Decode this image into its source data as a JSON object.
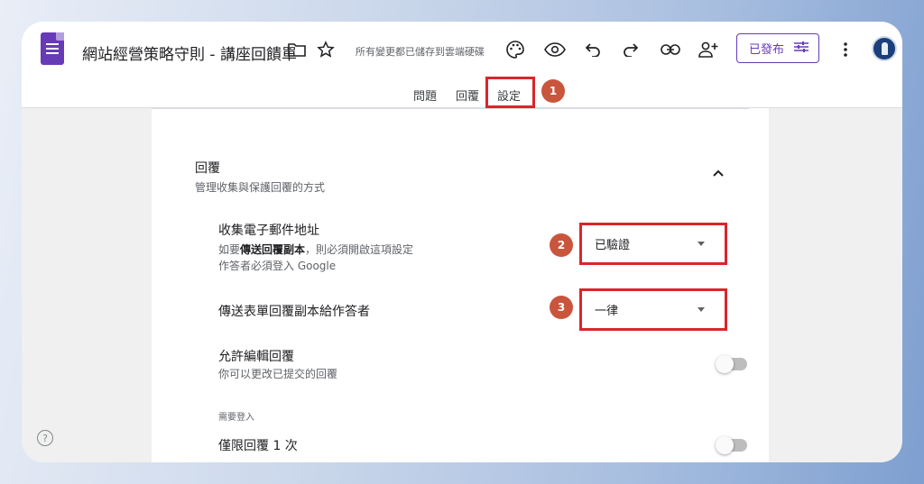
{
  "header": {
    "doc_title": "網站經營策略守則 - 講座回饋單",
    "saved_status": "所有變更都已儲存到雲端硬碟",
    "publish_label": "已發布"
  },
  "icons": [
    "forms-logo-icon",
    "folder-icon",
    "star-icon",
    "palette-icon",
    "eye-icon",
    "undo-icon",
    "redo-icon",
    "link-icon",
    "add-person-icon",
    "tune-icon",
    "more-vert-icon",
    "avatar",
    "chevron-up-icon",
    "dropdown-caret-icon",
    "help-icon"
  ],
  "tabs": [
    {
      "label": "問題"
    },
    {
      "label": "回覆"
    },
    {
      "label": "設定"
    }
  ],
  "annotations": {
    "badge1": "1",
    "badge2": "2",
    "badge3": "3",
    "highlight_color": "#d9262b",
    "badge_color": "#c9553c"
  },
  "section": {
    "title": "回覆",
    "subtitle": "管理收集與保護回覆的方式"
  },
  "settings": {
    "collect_email": {
      "title": "收集電子郵件地址",
      "desc_prefix": "如要",
      "desc_bold": "傳送回覆副本",
      "desc_suffix": "，則必須開啟這項設定",
      "desc_line2": "作答者必須登入 Google",
      "value": "已驗證"
    },
    "send_copy": {
      "title": "傳送表單回覆副本給作答者",
      "value": "一律"
    },
    "allow_edit": {
      "title": "允許編輯回覆",
      "desc": "你可以更改已提交的回覆",
      "enabled": false
    },
    "login_group": "需要登入",
    "limit_one": {
      "title": "僅限回覆 1 次",
      "enabled": false
    }
  },
  "colors": {
    "accent": "#673ab7",
    "card_bg": "#ffffff",
    "page_bg": "#f0f0f0"
  }
}
